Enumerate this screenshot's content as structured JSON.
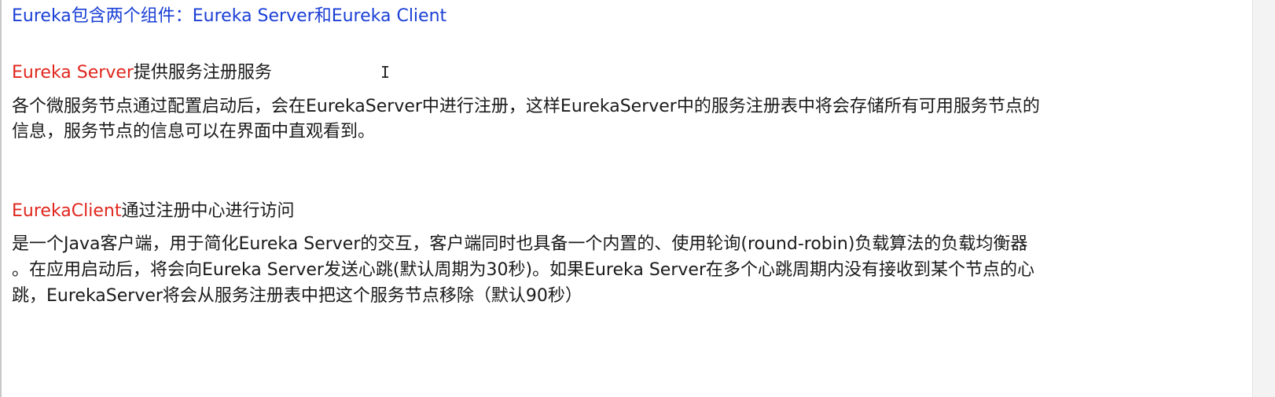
{
  "doc": {
    "title": "Eureka包含两个组件：Eureka Server和Eureka Client",
    "server": {
      "heading_red": "Eureka Server",
      "heading_rest": "提供服务注册服务",
      "body_line1": "各个微服务节点通过配置启动后，会在EurekaServer中进行注册，这样EurekaServer中的服务注册表中将会存储所有可用服务节点的",
      "body_line2": "信息，服务节点的信息可以在界面中直观看到。"
    },
    "client": {
      "heading_red": "EurekaClient",
      "heading_rest": "通过注册中心进行访问",
      "body_line1": "是一个Java客户端，用于简化Eureka Server的交互，客户端同时也具备一个内置的、使用轮询(round-robin)负载算法的负载均衡器",
      "body_line2": "。在应用启动后，将会向Eureka Server发送心跳(默认周期为30秒)。如果Eureka Server在多个心跳周期内没有接收到某个节点的心",
      "body_line3": "跳，EurekaServer将会从服务注册表中把这个服务节点移除（默认90秒）"
    }
  },
  "colors": {
    "title": "#1a3fd6",
    "highlight": "#e0261d",
    "text": "#1a1a1a"
  },
  "cursor_icon": "text-cursor-icon"
}
